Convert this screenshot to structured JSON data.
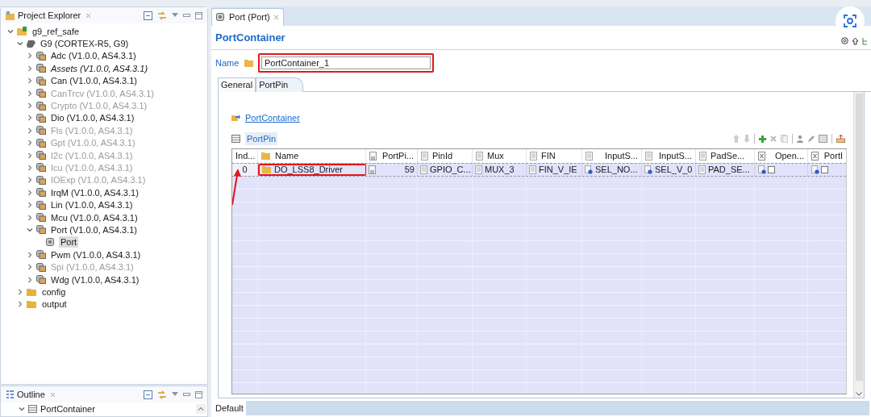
{
  "project_explorer": {
    "title": "Project Explorer",
    "tree": [
      {
        "label": "g9_ref_safe",
        "kind": "project",
        "expanded": true,
        "selected": false,
        "disabled": false,
        "italic": false,
        "children": [
          {
            "label": "G9 (CORTEX-R5, G9)",
            "kind": "chip",
            "expanded": true,
            "selected": false,
            "disabled": false,
            "italic": false,
            "children": [
              {
                "label": "Adc (V1.0.0, AS4.3.1)",
                "kind": "module",
                "expanded": false,
                "selected": false,
                "disabled": false,
                "italic": false
              },
              {
                "label": "Assets (V1.0.0, AS4.3.1)",
                "kind": "module",
                "expanded": false,
                "selected": false,
                "disabled": false,
                "italic": true
              },
              {
                "label": "Can (V1.0.0, AS4.3.1)",
                "kind": "module",
                "expanded": false,
                "selected": false,
                "disabled": false,
                "italic": false
              },
              {
                "label": "CanTrcv (V1.0.0, AS4.3.1)",
                "kind": "module",
                "expanded": false,
                "selected": false,
                "disabled": true,
                "italic": false
              },
              {
                "label": "Crypto (V1.0.0, AS4.3.1)",
                "kind": "module",
                "expanded": false,
                "selected": false,
                "disabled": true,
                "italic": false
              },
              {
                "label": "Dio (V1.0.0, AS4.3.1)",
                "kind": "module",
                "expanded": false,
                "selected": false,
                "disabled": false,
                "italic": false
              },
              {
                "label": "Fls (V1.0.0, AS4.3.1)",
                "kind": "module",
                "expanded": false,
                "selected": false,
                "disabled": true,
                "italic": false
              },
              {
                "label": "Gpt (V1.0.0, AS4.3.1)",
                "kind": "module",
                "expanded": false,
                "selected": false,
                "disabled": true,
                "italic": false
              },
              {
                "label": "I2c (V1.0.0, AS4.3.1)",
                "kind": "module",
                "expanded": false,
                "selected": false,
                "disabled": true,
                "italic": false
              },
              {
                "label": "Icu (V1.0.0, AS4.3.1)",
                "kind": "module",
                "expanded": false,
                "selected": false,
                "disabled": true,
                "italic": false
              },
              {
                "label": "IOExp (V1.0.0, AS4.3.1)",
                "kind": "module",
                "expanded": false,
                "selected": false,
                "disabled": true,
                "italic": false
              },
              {
                "label": "IrqM (V1.0.0, AS4.3.1)",
                "kind": "module",
                "expanded": false,
                "selected": false,
                "disabled": false,
                "italic": false
              },
              {
                "label": "Lin (V1.0.0, AS4.3.1)",
                "kind": "module",
                "expanded": false,
                "selected": false,
                "disabled": false,
                "italic": false
              },
              {
                "label": "Mcu (V1.0.0, AS4.3.1)",
                "kind": "module",
                "expanded": false,
                "selected": false,
                "disabled": false,
                "italic": false
              },
              {
                "label": "Port (V1.0.0, AS4.3.1)",
                "kind": "module",
                "expanded": true,
                "selected": false,
                "disabled": false,
                "italic": false,
                "children": [
                  {
                    "label": "Port",
                    "kind": "component",
                    "selected": true,
                    "disabled": false,
                    "italic": false
                  }
                ]
              },
              {
                "label": "Pwm (V1.0.0, AS4.3.1)",
                "kind": "module",
                "expanded": false,
                "selected": false,
                "disabled": false,
                "italic": false
              },
              {
                "label": "Spi (V1.0.0, AS4.3.1)",
                "kind": "module",
                "expanded": false,
                "selected": false,
                "disabled": true,
                "italic": false
              },
              {
                "label": "Wdg (V1.0.0, AS4.3.1)",
                "kind": "module",
                "expanded": false,
                "selected": false,
                "disabled": false,
                "italic": false
              }
            ]
          },
          {
            "label": "config",
            "kind": "folder",
            "expanded": false,
            "selected": false,
            "disabled": false,
            "italic": false
          },
          {
            "label": "output",
            "kind": "folder",
            "expanded": false,
            "selected": false,
            "disabled": false,
            "italic": false
          }
        ]
      }
    ]
  },
  "outline": {
    "title": "Outline",
    "items": [
      {
        "label": "PortContainer",
        "expanded": true
      }
    ]
  },
  "editor": {
    "tab": "Port (Port)",
    "heading": "PortContainer",
    "name_label": "Name",
    "name_value": "PortContainer_1",
    "name_highlighted": true,
    "tabs": [
      {
        "label": "General",
        "selected": false
      },
      {
        "label": "PortPin",
        "selected": true
      }
    ],
    "link": "PortContainer",
    "section": "PortPin",
    "table": {
      "columns": [
        {
          "label": "Ind...",
          "kind": "index"
        },
        {
          "label": "Name",
          "kind": "name"
        },
        {
          "label": "PortPi...",
          "kind": "number"
        },
        {
          "label": "PinId",
          "kind": "text"
        },
        {
          "label": "Mux",
          "kind": "text"
        },
        {
          "label": "FIN",
          "kind": "text"
        },
        {
          "label": "InputS...",
          "kind": "enum"
        },
        {
          "label": "InputS...",
          "kind": "enum"
        },
        {
          "label": "PadSe...",
          "kind": "text"
        },
        {
          "label": "Open...",
          "kind": "bool"
        },
        {
          "label": "PortI",
          "kind": "bool"
        }
      ],
      "rows": [
        {
          "highlighted": true,
          "cells": [
            {
              "text": "0"
            },
            {
              "text": "DO_LSS8_Driver"
            },
            {
              "text": "59"
            },
            {
              "text": "GPIO_C..."
            },
            {
              "text": "MUX_3"
            },
            {
              "text": "FIN_V_IE"
            },
            {
              "text": "SEL_NO..."
            },
            {
              "text": "SEL_V_0"
            },
            {
              "text": "PAD_SE..."
            },
            {
              "checked": false
            },
            {
              "checked": false
            }
          ]
        }
      ]
    },
    "bottom_tabs": [
      {
        "label": "Default",
        "selected": true
      }
    ]
  }
}
